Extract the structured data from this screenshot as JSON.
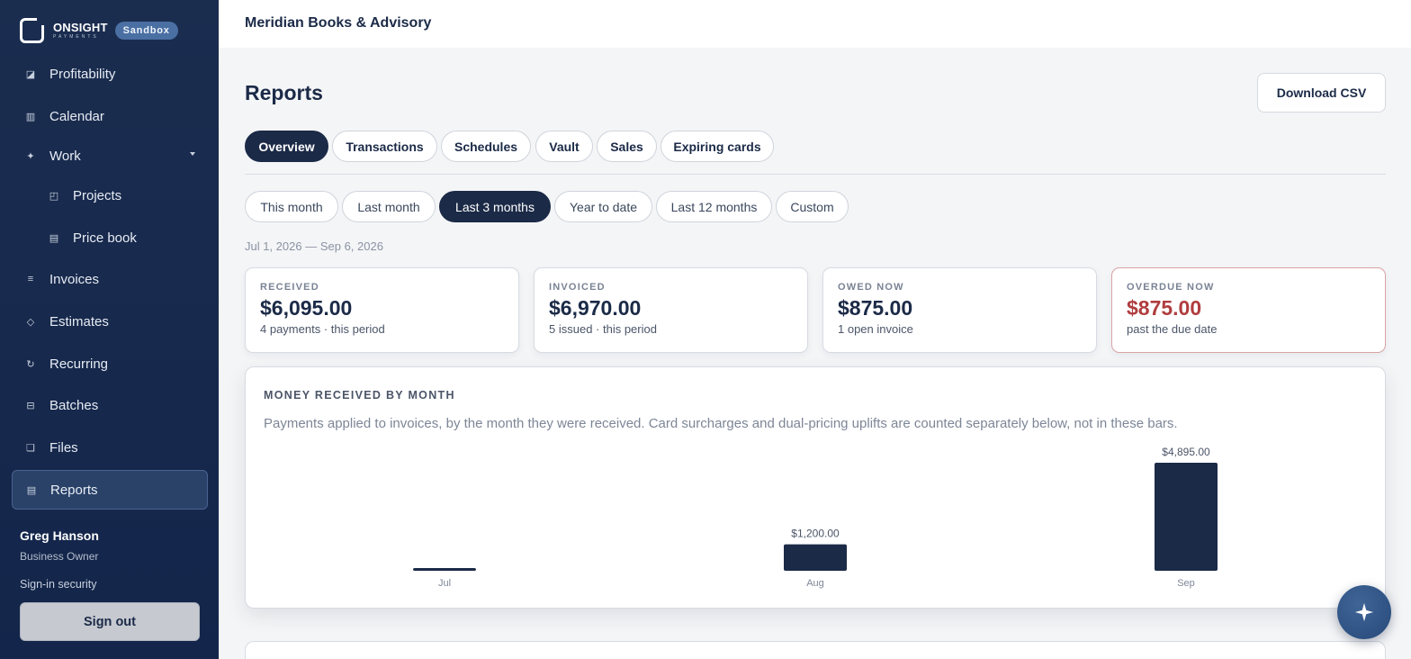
{
  "brand": {
    "name": "ONSIGHT",
    "sub": "PAYMENTS",
    "badge": "Sandbox"
  },
  "sidebar": {
    "items": [
      {
        "label": "Profitability",
        "icon": "chart-icon",
        "glyph": "◪"
      },
      {
        "label": "Calendar",
        "icon": "calendar-icon",
        "glyph": "▥"
      },
      {
        "label": "Work",
        "icon": "sparkle-icon",
        "glyph": "✦"
      },
      {
        "label": "Projects",
        "icon": "projects-icon",
        "glyph": "◰"
      },
      {
        "label": "Price book",
        "icon": "price-book-icon",
        "glyph": "▤"
      },
      {
        "label": "Invoices",
        "icon": "invoices-icon",
        "glyph": "≡"
      },
      {
        "label": "Estimates",
        "icon": "estimates-icon",
        "glyph": "◇"
      },
      {
        "label": "Recurring",
        "icon": "recurring-icon",
        "glyph": "↻"
      },
      {
        "label": "Batches",
        "icon": "batches-icon",
        "glyph": "⊟"
      },
      {
        "label": "Files",
        "icon": "files-icon",
        "glyph": "❏"
      },
      {
        "label": "Reports",
        "icon": "reports-icon",
        "glyph": "▤"
      }
    ],
    "user": {
      "name": "Greg Hanson",
      "role": "Business Owner"
    },
    "signin_security": "Sign-in security",
    "signout": "Sign out"
  },
  "header": {
    "org": "Meridian Books & Advisory"
  },
  "page": {
    "title": "Reports",
    "download": "Download CSV"
  },
  "tabs": [
    "Overview",
    "Transactions",
    "Schedules",
    "Vault",
    "Sales",
    "Expiring cards"
  ],
  "ranges": [
    "This month",
    "Last month",
    "Last 3 months",
    "Year to date",
    "Last 12 months",
    "Custom"
  ],
  "date_range": "Jul 1, 2026 — Sep 6, 2026",
  "cards": [
    {
      "label": "RECEIVED",
      "value": "$6,095.00",
      "note": "4 payments · this period"
    },
    {
      "label": "INVOICED",
      "value": "$6,970.00",
      "note": "5 issued · this period"
    },
    {
      "label": "OWED NOW",
      "value": "$875.00",
      "note": "1 open invoice"
    },
    {
      "label": "OVERDUE NOW",
      "value": "$875.00",
      "note": "past the due date"
    }
  ],
  "chart": {
    "title": "MONEY RECEIVED BY MONTH",
    "description": "Payments applied to invoices, by the month they were received. Card surcharges and dual-pricing uplifts are counted separately below, not in these bars."
  },
  "chart_data": {
    "type": "bar",
    "categories": [
      "Jul",
      "Aug",
      "Sep"
    ],
    "values": [
      0,
      1200,
      4895
    ],
    "data_labels": [
      "",
      "$1,200.00",
      "$4,895.00"
    ],
    "title": "MONEY RECEIVED BY MONTH",
    "xlabel": "",
    "ylabel": "",
    "ylim": [
      0,
      4895
    ],
    "grid": false,
    "bar_color": "#1b2a47"
  },
  "colors": {
    "navy": "#1b2a47",
    "alert": "#b03d3f",
    "sidebar": "#1b2d4f"
  }
}
